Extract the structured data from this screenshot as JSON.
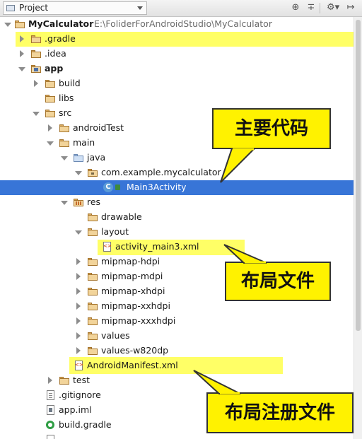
{
  "toolbar": {
    "project_label": "Project",
    "icons": [
      "target-icon",
      "collapse-icon",
      "gear-icon",
      "hide-icon"
    ]
  },
  "tree": {
    "root_name": "MyCalculator",
    "root_path": "E:\\FoliderForAndroidStudio\\MyCalculator",
    "gradle": ".gradle",
    "idea": ".idea",
    "app": "app",
    "build": "build",
    "libs": "libs",
    "src": "src",
    "androidTest": "androidTest",
    "main": "main",
    "java": "java",
    "package": "com.example.mycalculator",
    "activity_class": "Main3Activity",
    "res": "res",
    "drawable": "drawable",
    "layout": "layout",
    "layout_file": "activity_main3.xml",
    "mipmap_hdpi": "mipmap-hdpi",
    "mipmap_mdpi": "mipmap-mdpi",
    "mipmap_xhdpi": "mipmap-xhdpi",
    "mipmap_xxhdpi": "mipmap-xxhdpi",
    "mipmap_xxxhdpi": "mipmap-xxxhdpi",
    "values": "values",
    "values_w820dp": "values-w820dp",
    "manifest": "AndroidManifest.xml",
    "test": "test",
    "gitignore": ".gitignore",
    "app_iml": "app.iml",
    "build_gradle": "build.gradle"
  },
  "callouts": {
    "main_code": "主要代码",
    "layout_file": "布局文件",
    "layout_register": "布局注册文件"
  },
  "colors": {
    "selection": "#3875d7",
    "highlight": "#ffff66",
    "callout": "#fff200"
  }
}
